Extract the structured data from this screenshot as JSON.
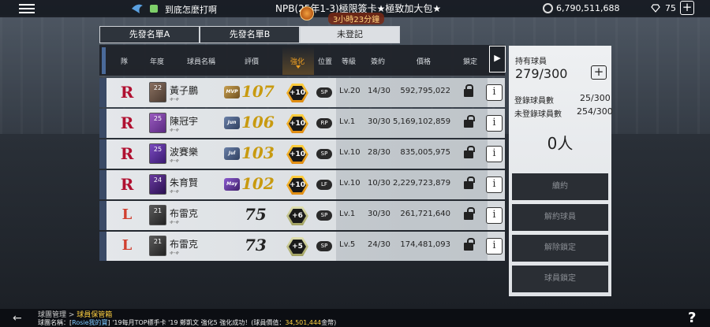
{
  "topbar": {
    "team_name": "到底怎麼打啊",
    "event_title": "NPB(25年1-3)極限簽卡★極致加大包★",
    "event_timer": "3小時23分鐘",
    "coins": "6,790,511,688",
    "gems": "75",
    "plus": "+"
  },
  "tabs": [
    {
      "label": "先發名單A",
      "active": false
    },
    {
      "label": "先發名單B",
      "active": false
    },
    {
      "label": "未登記",
      "active": true
    }
  ],
  "table": {
    "headers": {
      "team": "隊",
      "year": "年度",
      "name": "球員名稱",
      "rating": "評價",
      "enhance": "強化",
      "position": "位置",
      "level": "等級",
      "contract": "簽約",
      "price": "價格",
      "lock": "鎖定"
    },
    "rows": [
      {
        "team": "R",
        "year": "22",
        "name": "黃子鵬",
        "sub": "ቀ-ቀ",
        "rating_icon": "MVP",
        "rating": "107",
        "enhance": "+10",
        "pos": "SP",
        "level": "Lv.20",
        "contract": "14/30",
        "price": "592,795,022",
        "locked": true
      },
      {
        "team": "R",
        "year": "25",
        "name": "陳冠宇",
        "sub": "ቀ-ቀ",
        "rating_icon": "Jun",
        "rating": "106",
        "enhance": "+10",
        "pos": "RP",
        "level": "Lv.1",
        "contract": "30/30",
        "price": "5,169,102,859",
        "locked": false
      },
      {
        "team": "R",
        "year": "25",
        "name": "波賽樂",
        "sub": "ቀ-ቀ",
        "rating_icon": "Jul",
        "rating": "103",
        "enhance": "+10",
        "pos": "SP",
        "level": "Lv.10",
        "contract": "28/30",
        "price": "835,005,975",
        "locked": false
      },
      {
        "team": "R",
        "year": "24",
        "name": "朱育賢",
        "sub": "ቀ-ቀ",
        "rating_icon": "May",
        "rating": "102",
        "enhance": "+10",
        "pos": "LF",
        "level": "Lv.10",
        "contract": "10/30",
        "price": "2,229,723,879",
        "locked": false
      },
      {
        "team": "L",
        "year": "21",
        "name": "布雷克",
        "sub": "ቀ-ቀ",
        "rating_icon": "",
        "rating": "75",
        "enhance": "+6",
        "pos": "SP",
        "level": "Lv.1",
        "contract": "30/30",
        "price": "261,721,640",
        "locked": false
      },
      {
        "team": "L",
        "year": "21",
        "name": "布雷克",
        "sub": "ቀ-ቀ",
        "rating_icon": "",
        "rating": "73",
        "enhance": "+5",
        "pos": "SP",
        "level": "Lv.5",
        "contract": "24/30",
        "price": "174,481,093",
        "locked": false
      }
    ],
    "expand": "▶"
  },
  "panel": {
    "title": "持有球員",
    "count": "279/300",
    "add": "+",
    "registered_label": "登錄球員數",
    "registered_value": "25/300",
    "unregistered_label": "未登錄球員數",
    "unregistered_value": "254/300",
    "selected": "0人",
    "buttons": [
      "續約",
      "解約球員",
      "解除鎖定",
      "球員鎖定"
    ]
  },
  "bottom": {
    "back": "←",
    "crumb_root": "球團管理",
    "crumb_sep": " > ",
    "crumb_current": "球員保管箱",
    "ticker_prefix": "球團名稱：[",
    "ticker_team": "Rosie我的寶",
    "ticker_middle": "] '19每月TOP標手卡 '19 鄭凱文 強化5 強化成功！(球員價值：",
    "ticker_value": "34,501,444",
    "ticker_suffix": "金幣)",
    "help": "?"
  }
}
